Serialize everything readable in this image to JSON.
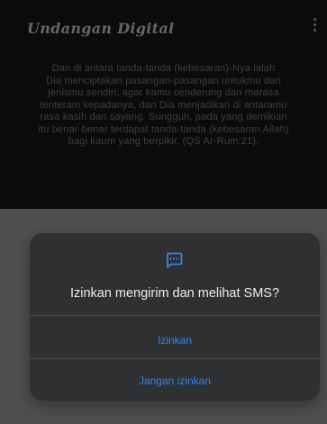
{
  "app": {
    "title": "Undangan Digital",
    "menu_icon": "more-vertical-icon",
    "verse_lines": [
      "Dan di antara tanda-tanda (kebesaran)-Nya ialah",
      "Dia menciptakan pasangan-pasangan untukmu dari",
      "jenismu sendiri, agar kamu cenderung dan merasa",
      "tenteram kepadanya, dan Dia menjadikan di antaramu",
      "rasa kasih dan sayang. Sungguh, pada yang demikian",
      "itu benar-benar terdapat tanda-tanda (kebesaran Allah)",
      "bagi kaum yang berpikir. (QS Ar-Rum:21)."
    ]
  },
  "dialog": {
    "icon": "sms-message-icon",
    "title": "Izinkan mengirim dan melihat SMS?",
    "allow_label": "Izinkan",
    "deny_label": "Jangan izinkan",
    "accent_color": "#2f86ea"
  }
}
